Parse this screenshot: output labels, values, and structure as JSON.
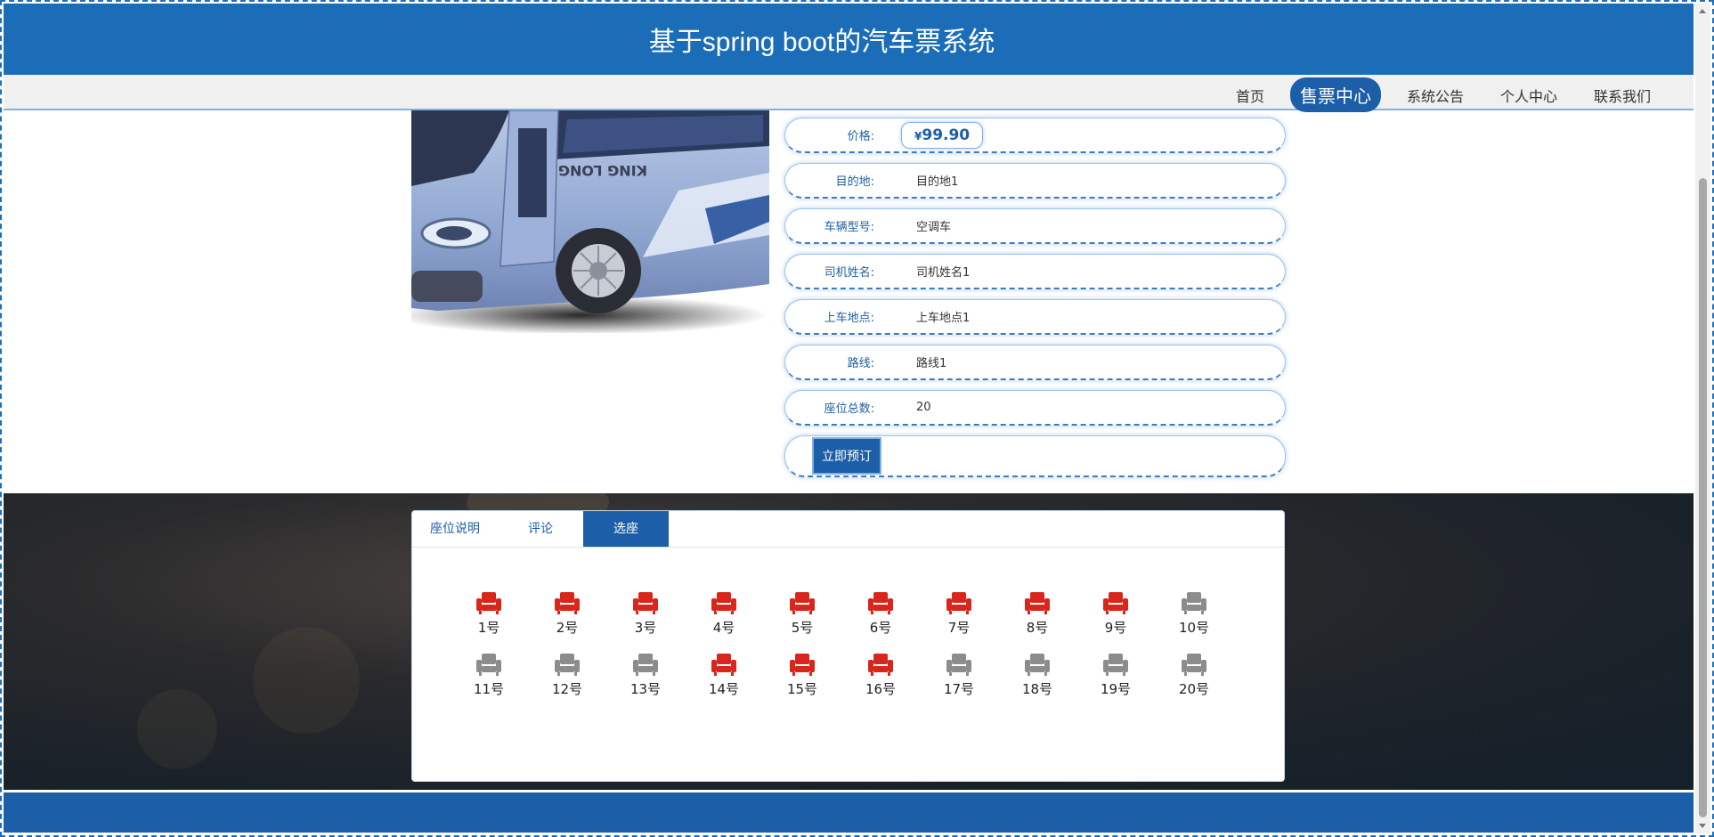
{
  "header": {
    "title": "基于spring boot的汽车票系统"
  },
  "nav": {
    "items": [
      "首页",
      "售票中心",
      "系统公告",
      "个人中心",
      "联系我们"
    ],
    "active": "售票中心"
  },
  "bus_image": {
    "brand_text": "KING LONG"
  },
  "info": {
    "price_label": "价格:",
    "price_currency": "¥",
    "price_value": "99.90",
    "destination_label": "目的地:",
    "destination_value": "目的地1",
    "vehicle_type_label": "车辆型号:",
    "vehicle_type_value": "空调车",
    "driver_label": "司机姓名:",
    "driver_value": "司机姓名1",
    "boarding_label": "上车地点:",
    "boarding_value": "上车地点1",
    "route_label": "路线:",
    "route_value": "路线1",
    "seats_total_label": "座位总数:",
    "seats_total_value": "20",
    "book_button": "立即预订"
  },
  "tabs": {
    "items": [
      "座位说明",
      "评论",
      "选座"
    ],
    "active": "选座"
  },
  "seats": [
    {
      "label": "1号",
      "status": "booked"
    },
    {
      "label": "2号",
      "status": "booked"
    },
    {
      "label": "3号",
      "status": "booked"
    },
    {
      "label": "4号",
      "status": "booked"
    },
    {
      "label": "5号",
      "status": "booked"
    },
    {
      "label": "6号",
      "status": "booked"
    },
    {
      "label": "7号",
      "status": "booked"
    },
    {
      "label": "8号",
      "status": "booked"
    },
    {
      "label": "9号",
      "status": "booked"
    },
    {
      "label": "10号",
      "status": "available"
    },
    {
      "label": "11号",
      "status": "available"
    },
    {
      "label": "12号",
      "status": "available"
    },
    {
      "label": "13号",
      "status": "available"
    },
    {
      "label": "14号",
      "status": "booked"
    },
    {
      "label": "15号",
      "status": "booked"
    },
    {
      "label": "16号",
      "status": "booked"
    },
    {
      "label": "17号",
      "status": "available"
    },
    {
      "label": "18号",
      "status": "available"
    },
    {
      "label": "19号",
      "status": "available"
    },
    {
      "label": "20号",
      "status": "available"
    }
  ],
  "colors": {
    "brand": "#1c6db8",
    "booked_seat": "#d9261c",
    "available_seat": "#8c8c8c"
  }
}
